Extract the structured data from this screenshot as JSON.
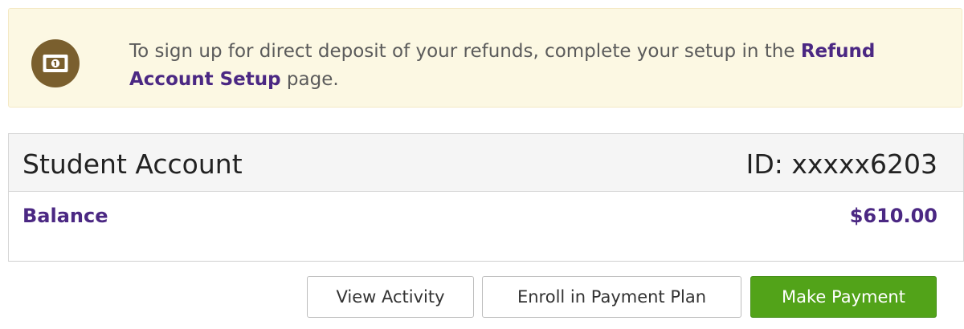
{
  "notice": {
    "icon": "money-bill-icon",
    "text_before": "To sign up for direct deposit of your refunds, complete your setup in the ",
    "link_label": "Refund Account Setup",
    "text_after": " page."
  },
  "account": {
    "title": "Student Account",
    "id_label": "ID: xxxxx6203",
    "balance_label": "Balance",
    "balance_value": "$610.00"
  },
  "actions": {
    "view_activity": "View Activity",
    "enroll_payment_plan": "Enroll in Payment Plan",
    "make_payment": "Make Payment"
  },
  "colors": {
    "brand_purple": "#4b2883",
    "notice_bg": "#fcf8e3",
    "icon_brown": "#7a5f2e",
    "primary_green": "#52a319"
  }
}
